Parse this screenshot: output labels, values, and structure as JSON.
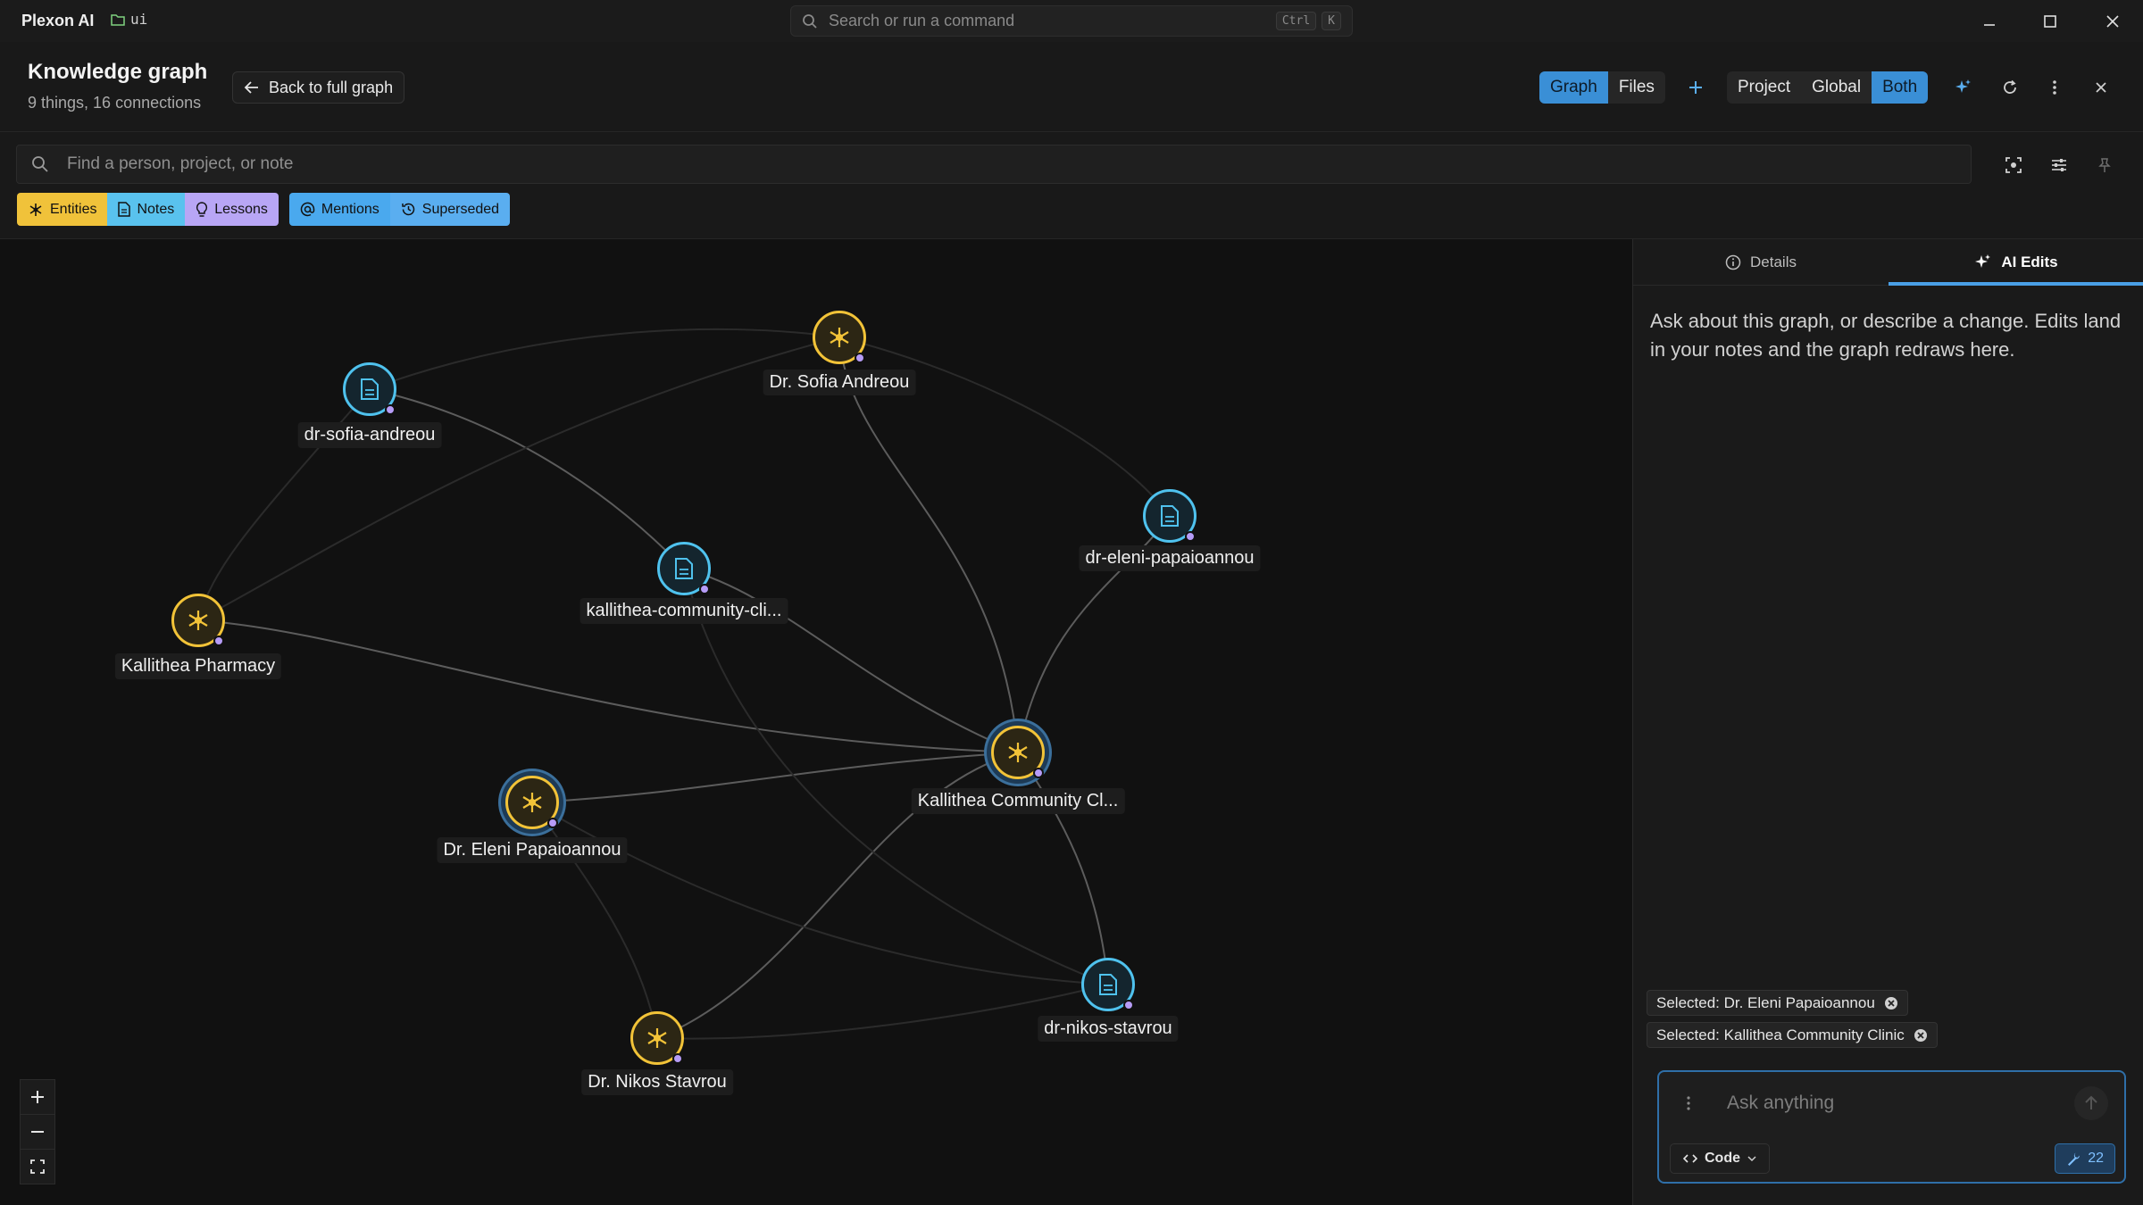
{
  "titlebar": {
    "app_name": "Plexon AI",
    "workspace": "ui",
    "command_placeholder": "Search or run a command",
    "shortcut_keys": [
      "Ctrl",
      "K"
    ]
  },
  "header": {
    "title": "Knowledge graph",
    "subtitle": "9 things, 16 connections",
    "back_label": "Back to full graph",
    "view_modes": [
      {
        "label": "Graph",
        "active": true
      },
      {
        "label": "Files",
        "active": false
      }
    ],
    "scopes": [
      {
        "label": "Project",
        "active": false
      },
      {
        "label": "Global",
        "active": false
      },
      {
        "label": "Both",
        "active": true
      }
    ]
  },
  "search": {
    "placeholder": "Find a person, project, or note"
  },
  "filters": {
    "kinds": [
      {
        "label": "Entities",
        "icon": "entity-icon"
      },
      {
        "label": "Notes",
        "icon": "note-icon"
      },
      {
        "label": "Lessons",
        "icon": "lightbulb-icon"
      }
    ],
    "edges": [
      {
        "label": "Mentions",
        "icon": "at-icon"
      },
      {
        "label": "Superseded",
        "icon": "history-icon"
      }
    ]
  },
  "graph": {
    "nodes": [
      {
        "id": "n1",
        "type": "entity",
        "label": "Dr. Sofia Andreou"
      },
      {
        "id": "n2",
        "type": "note",
        "label": "dr-sofia-andreou"
      },
      {
        "id": "n3",
        "type": "note",
        "label": "dr-eleni-papaioannou"
      },
      {
        "id": "n4",
        "type": "note",
        "label": "kallithea-community-cli..."
      },
      {
        "id": "n5",
        "type": "entity",
        "label": "Kallithea Pharmacy"
      },
      {
        "id": "n6",
        "type": "entity",
        "label": "Kallithea Community Cl...",
        "selected": true
      },
      {
        "id": "n7",
        "type": "entity",
        "label": "Dr. Eleni Papaioannou",
        "selected": true
      },
      {
        "id": "n8",
        "type": "note",
        "label": "dr-nikos-stavrou"
      },
      {
        "id": "n9",
        "type": "entity",
        "label": "Dr. Nikos Stavrou"
      }
    ]
  },
  "panel": {
    "tabs": [
      {
        "label": "Details",
        "active": false,
        "icon": "info-icon"
      },
      {
        "label": "AI Edits",
        "active": true,
        "icon": "sparkle-icon"
      }
    ],
    "intro": "Ask about this graph, or describe a change. Edits land in your notes and the graph redraws here.",
    "selected_context": [
      "Selected: Dr. Eleni Papaioannou",
      "Selected: Kallithea Community Clinic"
    ],
    "composer": {
      "placeholder": "Ask anything",
      "mode_label": "Code",
      "tools_count": "22"
    }
  },
  "colors": {
    "entity": "#f2c338",
    "note": "#4fc2ee",
    "accent": "#3a8fd6",
    "mention_dot": "#b69cf7"
  }
}
